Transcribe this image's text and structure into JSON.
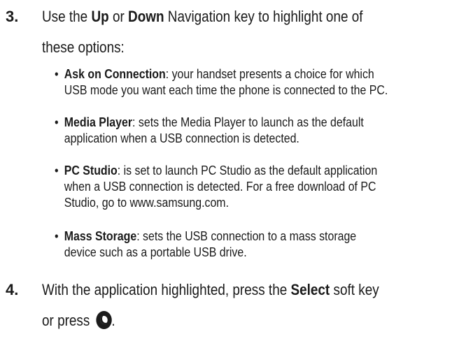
{
  "step3": {
    "number": "3.",
    "line1_pre": "Use the ",
    "up": "Up",
    "or": " or ",
    "down": "Down",
    "line1_post": " Navigation key to highlight one of",
    "line2": "these options:"
  },
  "options": [
    {
      "name": "Ask on Connection",
      "line1": ": your handset presents a choice for which",
      "line2": "USB mode you want each time the phone is connected to the PC.",
      "line3": ""
    },
    {
      "name": "Media Player",
      "line1": ": sets the Media Player to launch as the default",
      "line2": "application when a USB connection is detected.",
      "line3": ""
    },
    {
      "name": "PC Studio",
      "line1": ": is set to launch PC Studio as the default application",
      "line2": "when a USB connection is detected. For a free download of PC",
      "line3": "Studio, go to www.samsung.com."
    },
    {
      "name": "Mass Storage",
      "line1": ": sets the USB connection to a mass storage",
      "line2": "device such as a portable USB drive.",
      "line3": ""
    }
  ],
  "step4": {
    "number": "4.",
    "line1_pre": "With the application highlighted, press the ",
    "select": "Select",
    "line1_post": " soft key",
    "line2": "or press ",
    "line2_end": ".",
    "icon": "select-key-icon"
  }
}
